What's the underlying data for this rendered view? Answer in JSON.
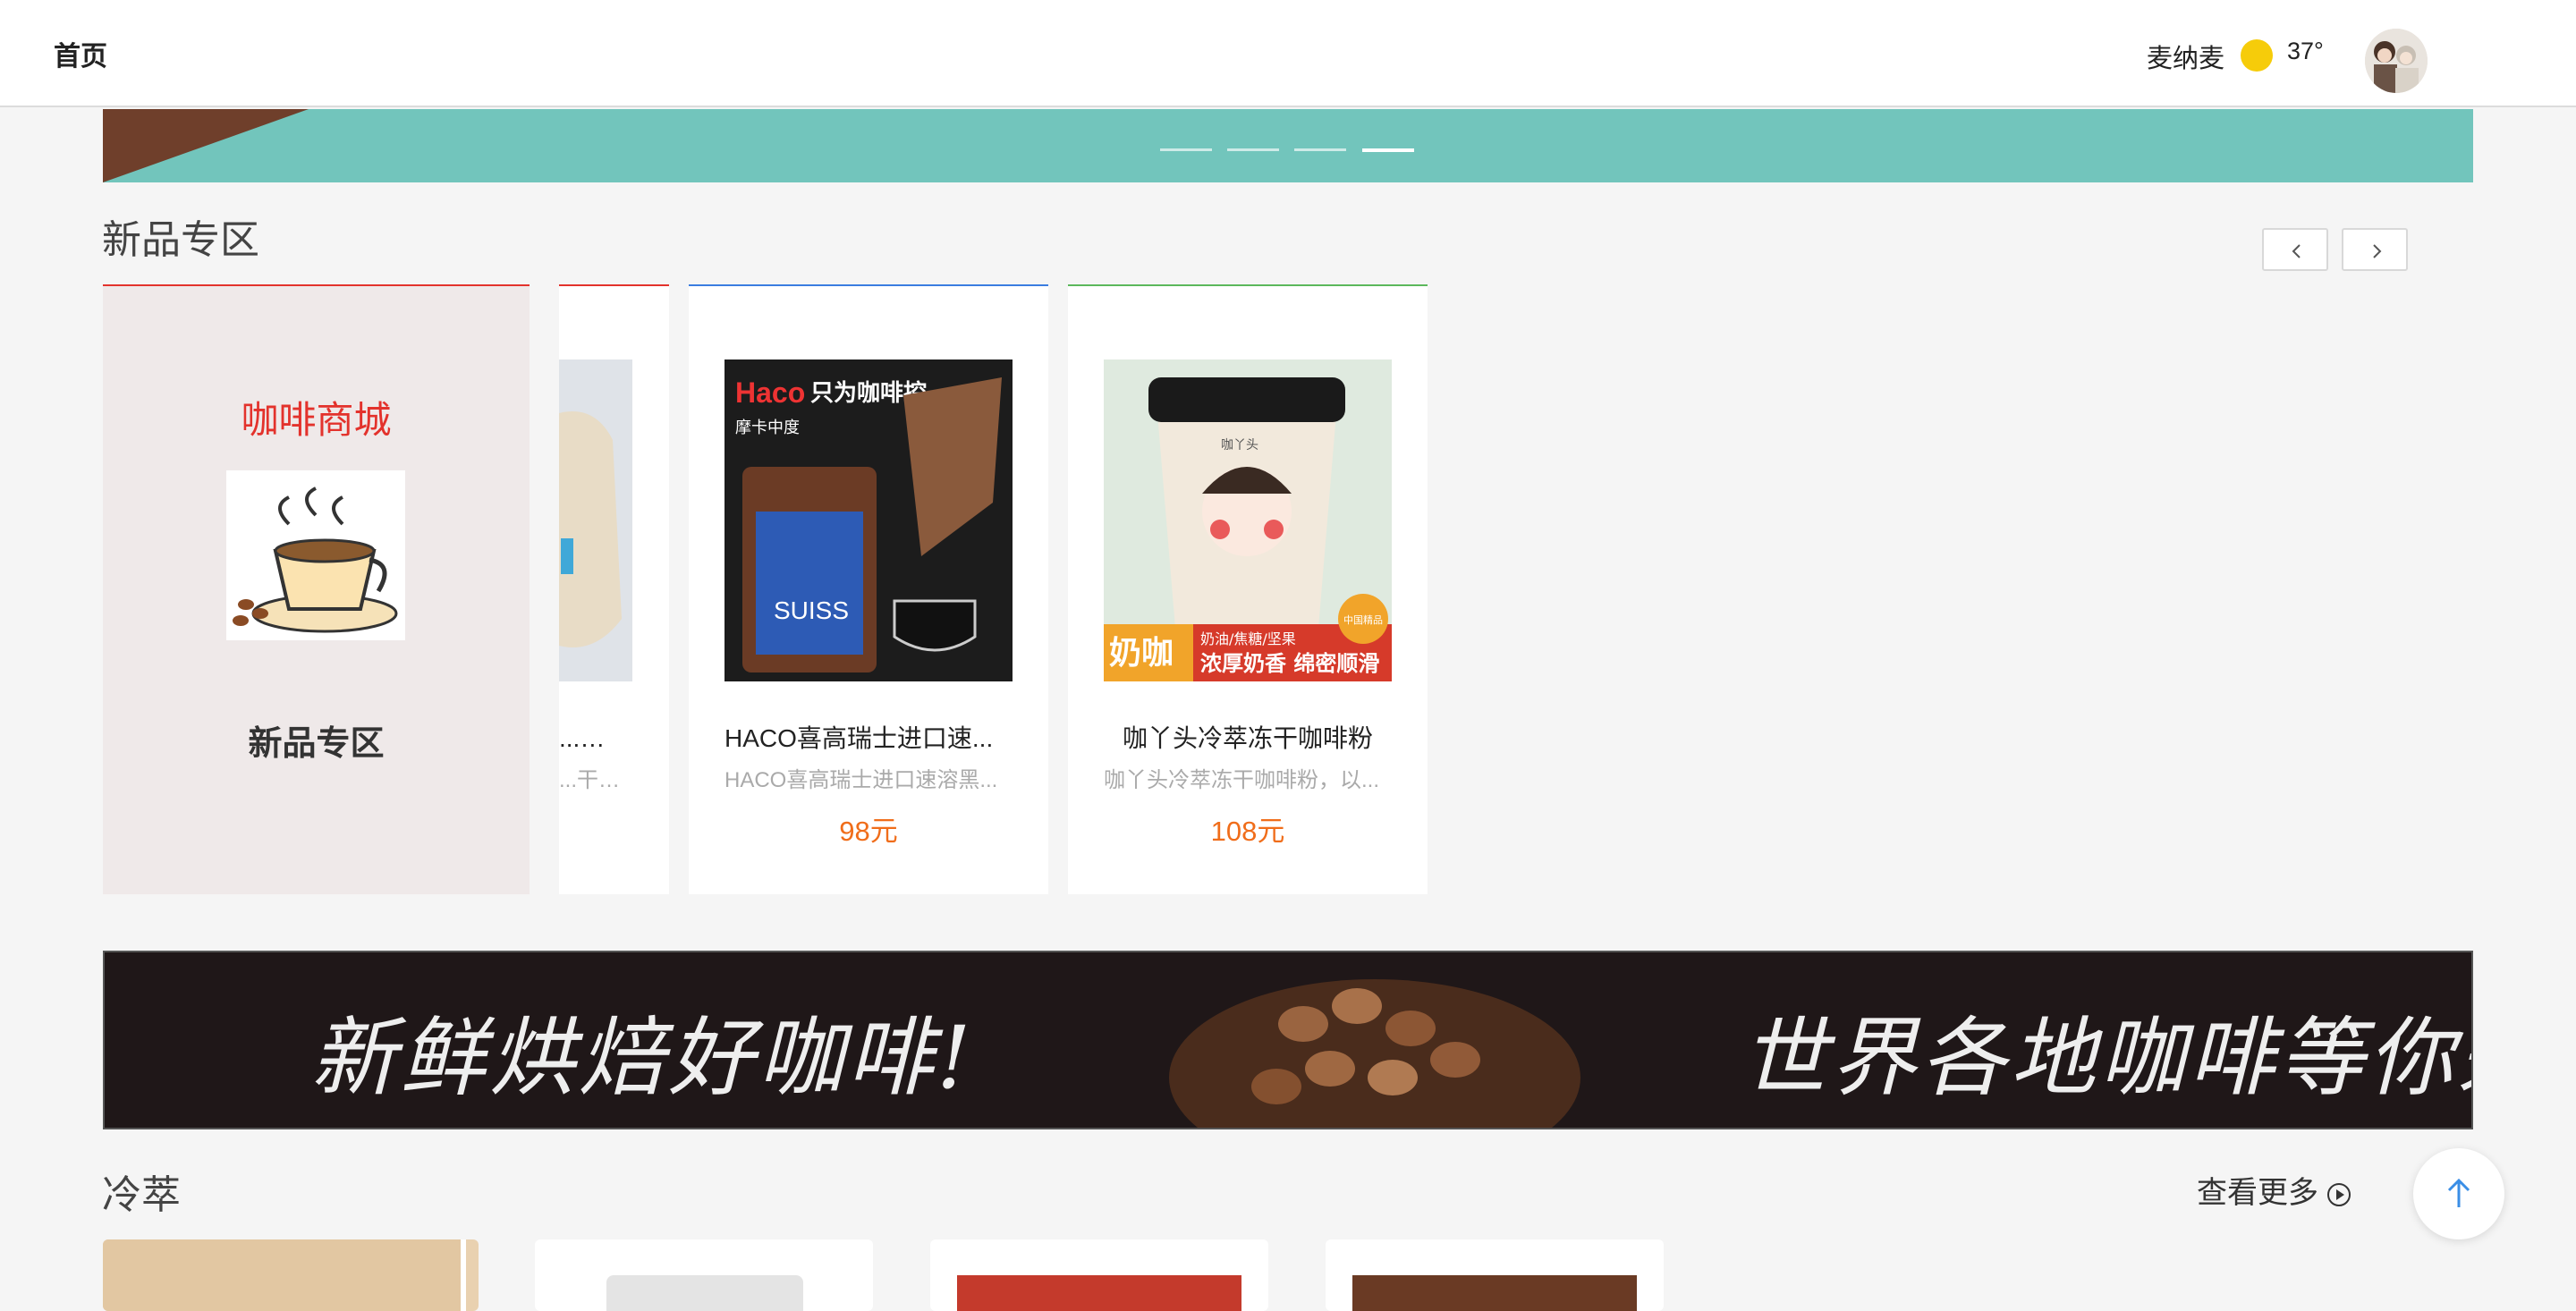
{
  "header": {
    "home": "首页",
    "user_name": "麦纳麦",
    "weather_icon": "sun-icon",
    "temperature": "37°"
  },
  "banner": {
    "dots": 4,
    "active_dot": 4
  },
  "new_section": {
    "title": "新品专区",
    "promo": {
      "brand": "咖啡商城",
      "label": "新品专区"
    },
    "products": [
      {
        "name": "...冻...",
        "desc": "...干速...",
        "price": ""
      },
      {
        "name": "HACO喜高瑞士进口速...",
        "desc": "HACO喜高瑞士进口速溶黑...",
        "price": "98元",
        "img_headline": "只为咖啡控",
        "img_brand": "Haco",
        "img_sub": "摩卡中度",
        "img_jar": "SUISS"
      },
      {
        "name": "咖丫头冷萃冻干咖啡粉",
        "desc": "咖丫头冷萃冻干咖啡粉，以...",
        "price": "108元",
        "img_tag": "奶咖",
        "img_flavors": "奶油/焦糖/坚果",
        "img_slogan": "浓厚奶香 绵密顺滑",
        "img_badge": "中国精品",
        "img_cup_label": "咖丫头"
      }
    ]
  },
  "promo_banner": {
    "left_text": "新鲜烘焙好咖啡!",
    "right_text": "世界各地咖啡等你来品尝!"
  },
  "cold_section": {
    "title": "冷萃",
    "more": "查看更多"
  },
  "colors": {
    "accent_red": "#e3322c",
    "price_orange": "#f06d1a",
    "banner_teal": "#72c5bc",
    "card_blue": "#3b7de0",
    "card_green": "#5cb85c"
  }
}
